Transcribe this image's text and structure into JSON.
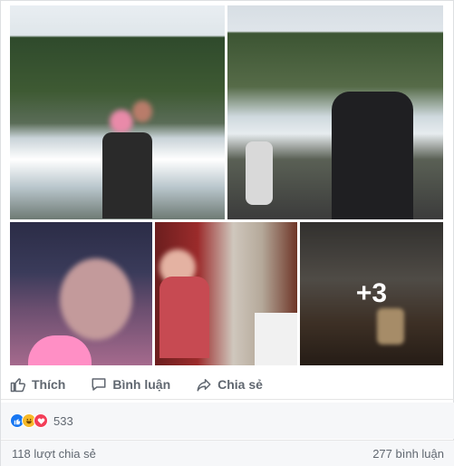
{
  "photos": {
    "more_count": "+3"
  },
  "actions": {
    "like_label": "Thích",
    "comment_label": "Bình luận",
    "share_label": "Chia sẻ"
  },
  "reactions": {
    "icons": [
      "like-icon",
      "haha-icon",
      "love-icon"
    ],
    "colors": {
      "like": "#1877f2",
      "haha": "#f7b928",
      "love": "#f33e58"
    },
    "count": "533"
  },
  "footer": {
    "shares": "118 lượt chia sẻ",
    "comments": "277 bình luận"
  }
}
